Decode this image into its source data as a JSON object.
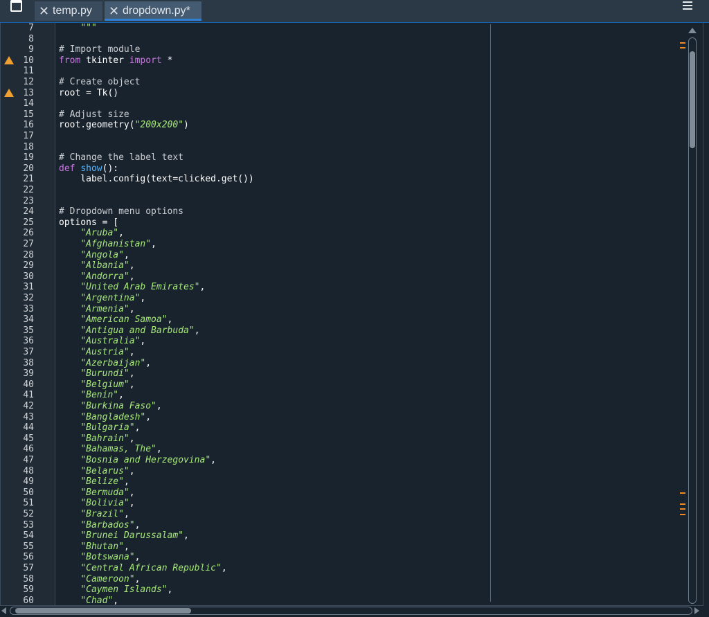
{
  "tabs": [
    {
      "label": "temp.py",
      "active": false
    },
    {
      "label": "dropdown.py*",
      "active": true
    }
  ],
  "editor": {
    "lines": [
      {
        "n": "7",
        "tokens": [
          [
            "    ",
            ""
          ],
          [
            "\"\"\"",
            "st"
          ]
        ]
      },
      {
        "n": "8",
        "tokens": []
      },
      {
        "n": "9",
        "tokens": [
          [
            "# Import module",
            "cm"
          ]
        ]
      },
      {
        "n": "10",
        "warn": true,
        "tokens": [
          [
            "from",
            "kw"
          ],
          [
            " tkinter ",
            ""
          ],
          [
            "import",
            "kw"
          ],
          [
            " *",
            ""
          ]
        ]
      },
      {
        "n": "11",
        "tokens": []
      },
      {
        "n": "12",
        "tokens": [
          [
            "# Create object",
            "cm"
          ]
        ]
      },
      {
        "n": "13",
        "warn": true,
        "tokens": [
          [
            "root = Tk()",
            ""
          ]
        ]
      },
      {
        "n": "14",
        "tokens": []
      },
      {
        "n": "15",
        "tokens": [
          [
            "# Adjust size",
            "cm"
          ]
        ]
      },
      {
        "n": "16",
        "tokens": [
          [
            "root.geometry(",
            ""
          ],
          [
            "\"200x200\"",
            "st"
          ],
          [
            ")",
            ""
          ]
        ]
      },
      {
        "n": "17",
        "tokens": []
      },
      {
        "n": "18",
        "tokens": []
      },
      {
        "n": "19",
        "tokens": [
          [
            "# Change the label text",
            "cm"
          ]
        ]
      },
      {
        "n": "20",
        "tokens": [
          [
            "def",
            "kw"
          ],
          [
            " ",
            ""
          ],
          [
            "show",
            "fn"
          ],
          [
            "():",
            ""
          ]
        ]
      },
      {
        "n": "21",
        "tokens": [
          [
            "    label.config(text=clicked.get())",
            ""
          ]
        ]
      },
      {
        "n": "22",
        "tokens": []
      },
      {
        "n": "23",
        "tokens": []
      },
      {
        "n": "24",
        "tokens": [
          [
            "# Dropdown menu options",
            "cm"
          ]
        ]
      },
      {
        "n": "25",
        "tokens": [
          [
            "options = [",
            ""
          ]
        ]
      },
      {
        "n": "26",
        "tokens": [
          [
            "    ",
            ""
          ],
          [
            "\"Aruba\"",
            "st"
          ],
          [
            ",",
            ""
          ]
        ]
      },
      {
        "n": "27",
        "tokens": [
          [
            "    ",
            ""
          ],
          [
            "\"Afghanistan\"",
            "st"
          ],
          [
            ",",
            ""
          ]
        ]
      },
      {
        "n": "28",
        "tokens": [
          [
            "    ",
            ""
          ],
          [
            "\"Angola\"",
            "st"
          ],
          [
            ",",
            ""
          ]
        ]
      },
      {
        "n": "29",
        "tokens": [
          [
            "    ",
            ""
          ],
          [
            "\"Albania\"",
            "st"
          ],
          [
            ",",
            ""
          ]
        ]
      },
      {
        "n": "30",
        "tokens": [
          [
            "    ",
            ""
          ],
          [
            "\"Andorra\"",
            "st"
          ],
          [
            ",",
            ""
          ]
        ]
      },
      {
        "n": "31",
        "tokens": [
          [
            "    ",
            ""
          ],
          [
            "\"United Arab Emirates\"",
            "st"
          ],
          [
            ",",
            ""
          ]
        ]
      },
      {
        "n": "32",
        "tokens": [
          [
            "    ",
            ""
          ],
          [
            "\"Argentina\"",
            "st"
          ],
          [
            ",",
            ""
          ]
        ]
      },
      {
        "n": "33",
        "tokens": [
          [
            "    ",
            ""
          ],
          [
            "\"Armenia\"",
            "st"
          ],
          [
            ",",
            ""
          ]
        ]
      },
      {
        "n": "34",
        "tokens": [
          [
            "    ",
            ""
          ],
          [
            "\"American Samoa\"",
            "st"
          ],
          [
            ",",
            ""
          ]
        ]
      },
      {
        "n": "35",
        "tokens": [
          [
            "    ",
            ""
          ],
          [
            "\"Antigua and Barbuda\"",
            "st"
          ],
          [
            ",",
            ""
          ]
        ]
      },
      {
        "n": "36",
        "tokens": [
          [
            "    ",
            ""
          ],
          [
            "\"Australia\"",
            "st"
          ],
          [
            ",",
            ""
          ]
        ]
      },
      {
        "n": "37",
        "tokens": [
          [
            "    ",
            ""
          ],
          [
            "\"Austria\"",
            "st"
          ],
          [
            ",",
            ""
          ]
        ]
      },
      {
        "n": "38",
        "tokens": [
          [
            "    ",
            ""
          ],
          [
            "\"Azerbaijan\"",
            "st"
          ],
          [
            ",",
            ""
          ]
        ]
      },
      {
        "n": "39",
        "tokens": [
          [
            "    ",
            ""
          ],
          [
            "\"Burundi\"",
            "st"
          ],
          [
            ",",
            ""
          ]
        ]
      },
      {
        "n": "40",
        "tokens": [
          [
            "    ",
            ""
          ],
          [
            "\"Belgium\"",
            "st"
          ],
          [
            ",",
            ""
          ]
        ]
      },
      {
        "n": "41",
        "tokens": [
          [
            "    ",
            ""
          ],
          [
            "\"Benin\"",
            "st"
          ],
          [
            ",",
            ""
          ]
        ]
      },
      {
        "n": "42",
        "tokens": [
          [
            "    ",
            ""
          ],
          [
            "\"Burkina Faso\"",
            "st"
          ],
          [
            ",",
            ""
          ]
        ]
      },
      {
        "n": "43",
        "tokens": [
          [
            "    ",
            ""
          ],
          [
            "\"Bangladesh\"",
            "st"
          ],
          [
            ",",
            ""
          ]
        ]
      },
      {
        "n": "44",
        "tokens": [
          [
            "    ",
            ""
          ],
          [
            "\"Bulgaria\"",
            "st"
          ],
          [
            ",",
            ""
          ]
        ]
      },
      {
        "n": "45",
        "tokens": [
          [
            "    ",
            ""
          ],
          [
            "\"Bahrain\"",
            "st"
          ],
          [
            ",",
            ""
          ]
        ]
      },
      {
        "n": "46",
        "tokens": [
          [
            "    ",
            ""
          ],
          [
            "\"Bahamas, The\"",
            "st"
          ],
          [
            ",",
            ""
          ]
        ]
      },
      {
        "n": "47",
        "tokens": [
          [
            "    ",
            ""
          ],
          [
            "\"Bosnia and Herzegovina\"",
            "st"
          ],
          [
            ",",
            ""
          ]
        ]
      },
      {
        "n": "48",
        "tokens": [
          [
            "    ",
            ""
          ],
          [
            "\"Belarus\"",
            "st"
          ],
          [
            ",",
            ""
          ]
        ]
      },
      {
        "n": "49",
        "tokens": [
          [
            "    ",
            ""
          ],
          [
            "\"Belize\"",
            "st"
          ],
          [
            ",",
            ""
          ]
        ]
      },
      {
        "n": "50",
        "tokens": [
          [
            "    ",
            ""
          ],
          [
            "\"Bermuda\"",
            "st"
          ],
          [
            ",",
            ""
          ]
        ]
      },
      {
        "n": "51",
        "tokens": [
          [
            "    ",
            ""
          ],
          [
            "\"Bolivia\"",
            "st"
          ],
          [
            ",",
            ""
          ]
        ]
      },
      {
        "n": "52",
        "tokens": [
          [
            "    ",
            ""
          ],
          [
            "\"Brazil\"",
            "st"
          ],
          [
            ",",
            ""
          ]
        ]
      },
      {
        "n": "53",
        "tokens": [
          [
            "    ",
            ""
          ],
          [
            "\"Barbados\"",
            "st"
          ],
          [
            ",",
            ""
          ]
        ]
      },
      {
        "n": "54",
        "tokens": [
          [
            "    ",
            ""
          ],
          [
            "\"Brunei Darussalam\"",
            "st"
          ],
          [
            ",",
            ""
          ]
        ]
      },
      {
        "n": "55",
        "tokens": [
          [
            "    ",
            ""
          ],
          [
            "\"Bhutan\"",
            "st"
          ],
          [
            ",",
            ""
          ]
        ]
      },
      {
        "n": "56",
        "tokens": [
          [
            "    ",
            ""
          ],
          [
            "\"Botswana\"",
            "st"
          ],
          [
            ",",
            ""
          ]
        ]
      },
      {
        "n": "57",
        "tokens": [
          [
            "    ",
            ""
          ],
          [
            "\"Central African Republic\"",
            "st"
          ],
          [
            ",",
            ""
          ]
        ]
      },
      {
        "n": "58",
        "tokens": [
          [
            "    ",
            ""
          ],
          [
            "\"Cameroon\"",
            "st"
          ],
          [
            ",",
            ""
          ]
        ]
      },
      {
        "n": "59",
        "tokens": [
          [
            "    ",
            ""
          ],
          [
            "\"Caymen Islands\"",
            "st"
          ],
          [
            ",",
            ""
          ]
        ]
      },
      {
        "n": "60",
        "tokens": [
          [
            "    ",
            ""
          ],
          [
            "\"Chad\"",
            "st"
          ],
          [
            ",",
            ""
          ]
        ]
      }
    ]
  },
  "colors": {
    "background": "#19232d",
    "comment": "#c9cdd1",
    "keyword": "#c678dd",
    "function": "#56b6ff",
    "string": "#a6e878",
    "warning": "#f0a030",
    "active_tab_underline": "#2f80d6"
  },
  "icons": {
    "window_control": "window-icon",
    "tab_close": "close-icon",
    "menu": "hamburger-menu-icon",
    "warning": "warning-triangle-icon"
  }
}
